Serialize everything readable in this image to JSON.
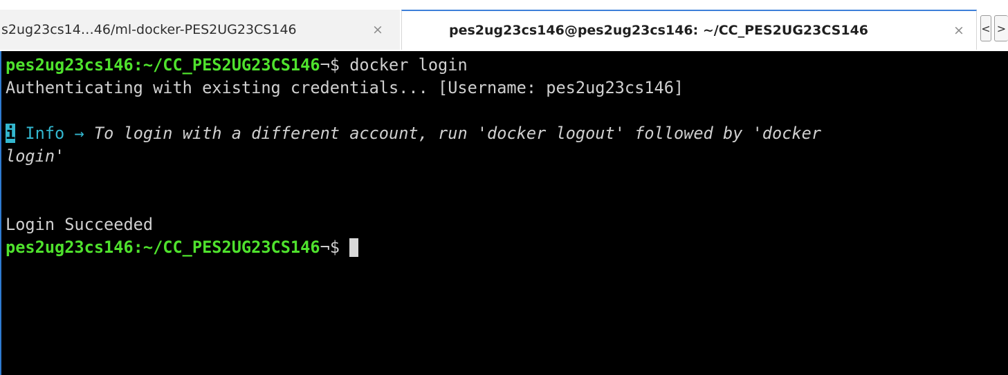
{
  "tabs": [
    {
      "label": "s2ug23cs14…46/ml-docker-PES2UG23CS146",
      "close": "×",
      "active": false
    },
    {
      "label": "pes2ug23cs146@pes2ug23cs146: ~/CC_PES2UG23CS146",
      "close": "×",
      "active": true
    }
  ],
  "tab_scroll": {
    "left": "<",
    "right": ">"
  },
  "terminal": {
    "prompt_user": "pes2ug23cs146:~/CC_PES2UG23CS146",
    "prompt_symbol": "¬$ ",
    "command": "docker login",
    "auth_line": "Authenticating with existing credentials... [Username: pes2ug23cs146]",
    "info_badge": "i",
    "info_label": " Info ",
    "info_arrow": "→ ",
    "info_text_1": "To login with a different account, run 'docker logout' followed by 'docker",
    "info_text_2": "login'",
    "success": "Login Succeeded"
  },
  "colors": {
    "prompt": "#4fe22d",
    "info": "#33b7cf",
    "terminal_bg": "#000000",
    "active_tab_accent": "#3d7fd9"
  }
}
